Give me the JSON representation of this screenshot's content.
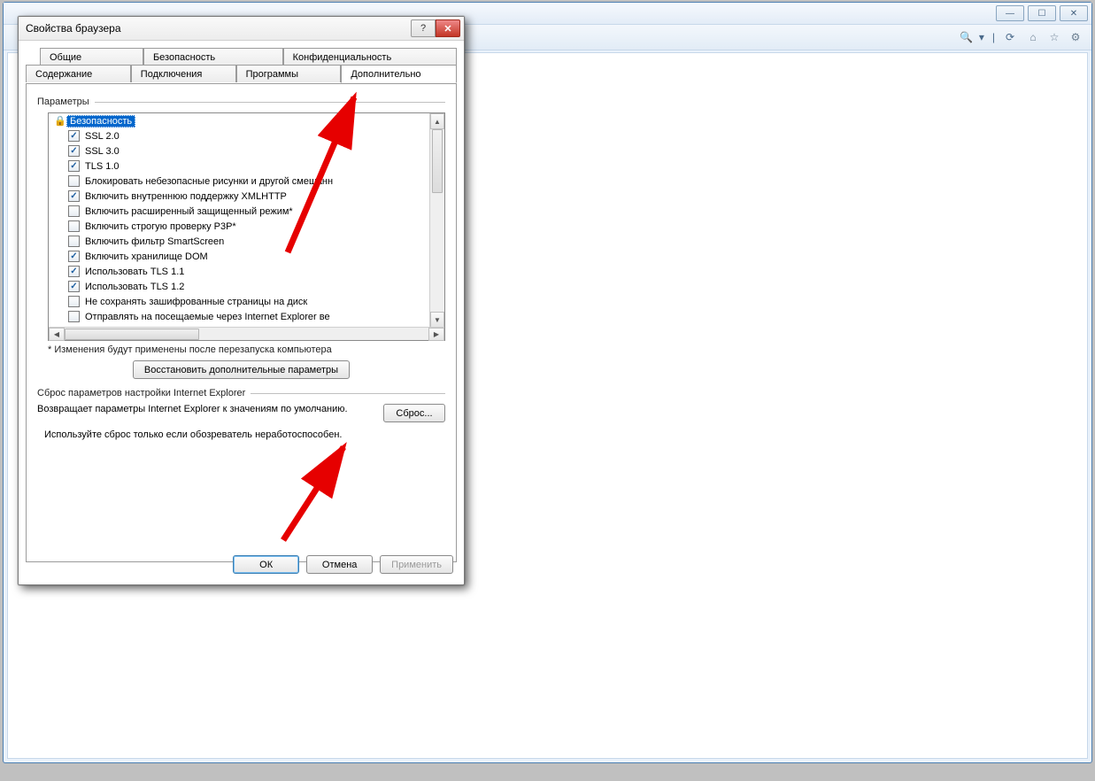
{
  "dialog": {
    "title": "Свойства браузера",
    "buttons": {
      "ok": "ОК",
      "cancel": "Отмена",
      "apply": "Применить"
    }
  },
  "tabs": {
    "row1": [
      "Общие",
      "Безопасность",
      "Конфиденциальность"
    ],
    "row2": [
      "Содержание",
      "Подключения",
      "Программы",
      "Дополнительно"
    ],
    "active": "Дополнительно"
  },
  "settings_section": {
    "legend": "Параметры",
    "category": "Безопасность",
    "note": "* Изменения будут применены после перезапуска компьютера",
    "restore_button": "Восстановить дополнительные параметры",
    "items": [
      {
        "label": "SSL 2.0",
        "checked": true
      },
      {
        "label": "SSL 3.0",
        "checked": true
      },
      {
        "label": "TLS 1.0",
        "checked": true
      },
      {
        "label": "Блокировать небезопасные рисунки и другой смешанн",
        "checked": false
      },
      {
        "label": "Включить внутреннюю поддержку XMLHTTP",
        "checked": true
      },
      {
        "label": "Включить расширенный защищенный режим*",
        "checked": false
      },
      {
        "label": "Включить строгую проверку P3P*",
        "checked": false
      },
      {
        "label": "Включить фильтр SmartScreen",
        "checked": false
      },
      {
        "label": "Включить хранилище DOM",
        "checked": true
      },
      {
        "label": "Использовать TLS 1.1",
        "checked": true
      },
      {
        "label": "Использовать TLS 1.2",
        "checked": true
      },
      {
        "label": "Не сохранять зашифрованные страницы на диск",
        "checked": false
      },
      {
        "label": "Отправлять на посещаемые через Internet Explorer ве",
        "checked": false
      }
    ]
  },
  "reset_section": {
    "legend": "Сброс параметров настройки Internet Explorer",
    "desc": "Возвращает параметры Internet Explorer к значениям по умолчанию.",
    "button": "Сброс...",
    "warning": "Используйте сброс только если обозреватель неработоспособен."
  }
}
